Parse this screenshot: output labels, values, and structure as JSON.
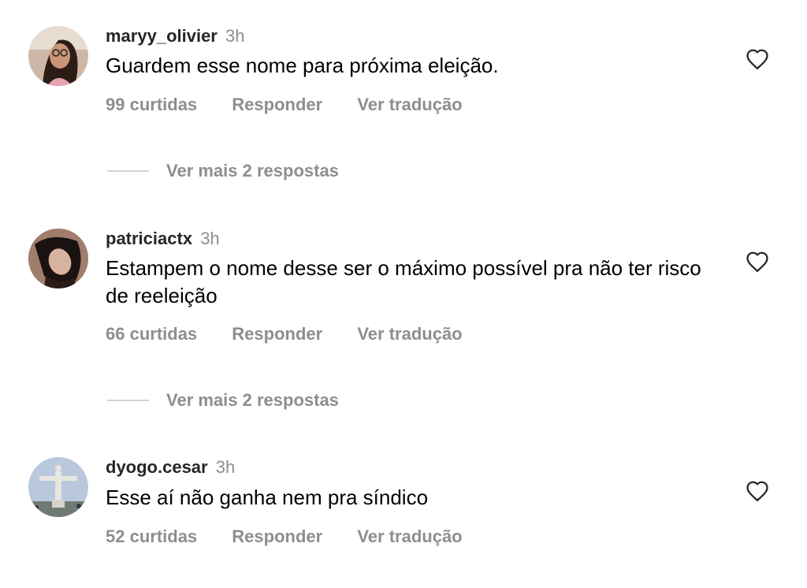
{
  "comments": [
    {
      "username": "maryy_olivier",
      "time": "3h",
      "text": "Guardem esse nome para próxima eleição.",
      "likes": "99 curtidas",
      "reply_label": "Responder",
      "translate_label": "Ver tradução",
      "more_replies": "Ver mais 2 respostas",
      "avatar_icon": "profile-photo-woman-glasses"
    },
    {
      "username": "patriciactx",
      "time": "3h",
      "text": "Estampem o nome desse ser o máximo possível pra não ter risco de reeleição",
      "likes": "66 curtidas",
      "reply_label": "Responder",
      "translate_label": "Ver tradução",
      "more_replies": "Ver mais 2 respostas",
      "avatar_icon": "profile-photo-woman-dark-hair"
    },
    {
      "username": "dyogo.cesar",
      "time": "3h",
      "text": "Esse aí não ganha nem pra síndico",
      "likes": "52 curtidas",
      "reply_label": "Responder",
      "translate_label": "Ver tradução",
      "avatar_icon": "profile-photo-christ-redeemer-statue"
    }
  ],
  "icons": {
    "like": "heart-outline-icon"
  },
  "colors": {
    "text": "#000000",
    "username": "#262626",
    "secondary": "#8e8e8e",
    "divider": "#d4d4d4"
  }
}
